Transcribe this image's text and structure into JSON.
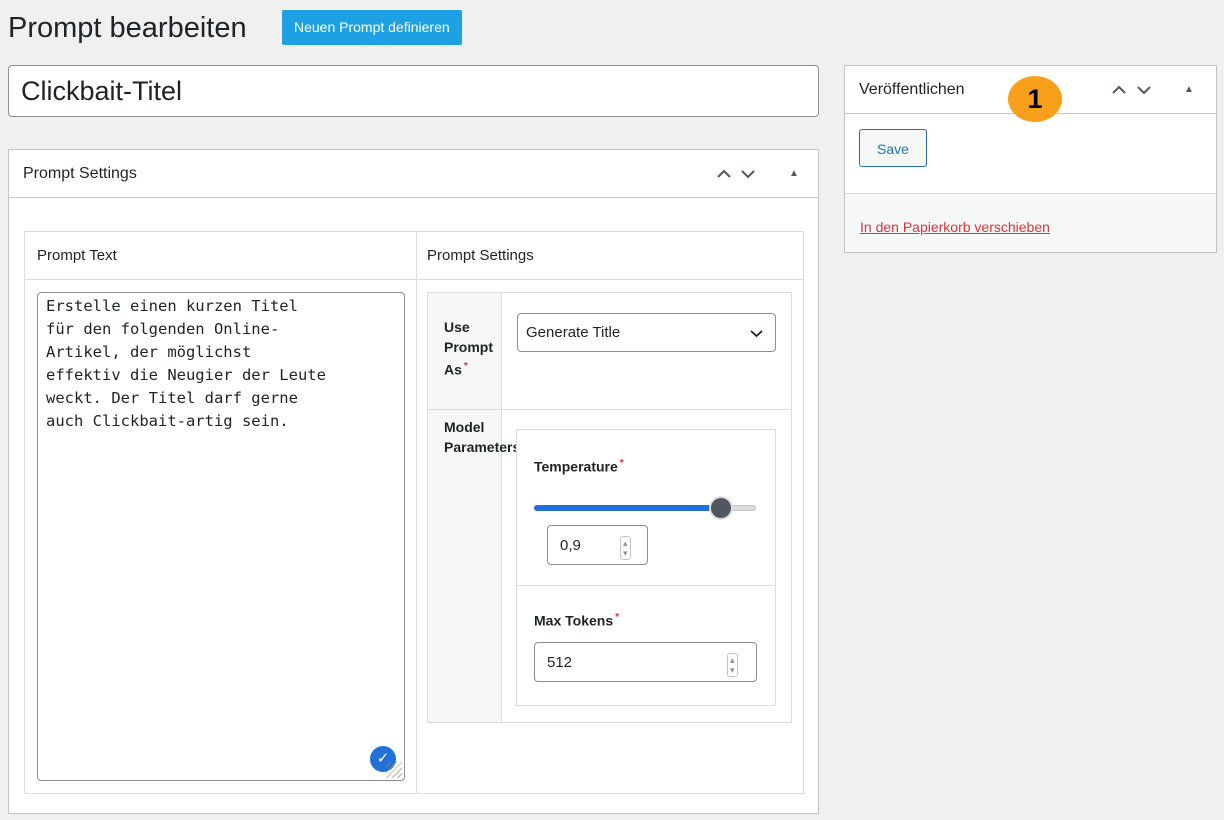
{
  "header": {
    "page_title": "Prompt bearbeiten",
    "add_new_label": "Neuen Prompt definieren"
  },
  "title_field": {
    "value": "Clickbait-Titel"
  },
  "main_box": {
    "title": "Prompt Settings",
    "controls": {
      "up": "^",
      "down": "v",
      "toggle": "▲"
    },
    "columns": {
      "left": "Prompt Text",
      "right": "Prompt Settings"
    },
    "prompt_text": "Erstelle einen kurzen Titel\nfür den folgenden Online-\nArtikel, der möglichst\neffektiv die Neugier der Leute\nweckt. Der Titel darf gerne\nauch Clickbait-artig sein.",
    "use_prompt_as": {
      "label_line1": "Use",
      "label_line2": "Prompt",
      "label_line3": "As",
      "required": "*",
      "selected": "Generate Title"
    },
    "model_params": {
      "label_line1": "Model",
      "label_line2": "Parameters",
      "temperature": {
        "label": "Temperature",
        "required": "*",
        "value": "0,9",
        "slider_fraction": 0.9
      },
      "max_tokens": {
        "label": "Max Tokens",
        "required": "*",
        "value": "512"
      }
    }
  },
  "publish_box": {
    "title": "Veröffentlichen",
    "controls": {
      "up": "^",
      "down": "v",
      "toggle": "▲"
    },
    "save_label": "Save",
    "trash_label": "In den Papierkorb verschieben",
    "badge": "1"
  },
  "colors": {
    "accent": "#2271b1",
    "add_new_bg": "#1ea1e4",
    "danger": "#d63638",
    "badge": "#f8a01b"
  }
}
